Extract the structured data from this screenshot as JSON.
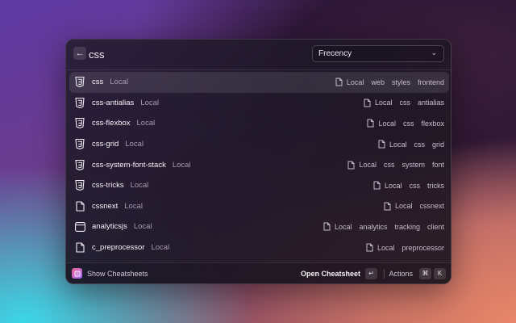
{
  "search": {
    "back_icon": "arrow-left-icon",
    "query": "css",
    "sort": {
      "selected": "Frecency",
      "chevron": "chevron-down-icon"
    }
  },
  "results": [
    {
      "title": "css",
      "subtitle": "Local",
      "icon": "css3-icon",
      "selected": true,
      "tags": [
        "Local",
        "web",
        "styles",
        "frontend"
      ]
    },
    {
      "title": "css-antialias",
      "subtitle": "Local",
      "icon": "css3-icon",
      "tags": [
        "Local",
        "css",
        "antialias"
      ]
    },
    {
      "title": "css-flexbox",
      "subtitle": "Local",
      "icon": "css3-icon",
      "tags": [
        "Local",
        "css",
        "flexbox"
      ]
    },
    {
      "title": "css-grid",
      "subtitle": "Local",
      "icon": "css3-icon",
      "tags": [
        "Local",
        "css",
        "grid"
      ]
    },
    {
      "title": "css-system-font-stack",
      "subtitle": "Local",
      "icon": "css3-icon",
      "tags": [
        "Local",
        "css",
        "system",
        "font"
      ]
    },
    {
      "title": "css-tricks",
      "subtitle": "Local",
      "icon": "css3-icon",
      "tags": [
        "Local",
        "css",
        "tricks"
      ]
    },
    {
      "title": "cssnext",
      "subtitle": "Local",
      "icon": "file-icon",
      "tags": [
        "Local",
        "cssnext"
      ]
    },
    {
      "title": "analyticsjs",
      "subtitle": "Local",
      "icon": "window-icon",
      "tags": [
        "Local",
        "analytics",
        "tracking",
        "client"
      ]
    },
    {
      "title": "c_preprocessor",
      "subtitle": "Local",
      "icon": "file-icon",
      "tags": [
        "Local",
        "preprocessor"
      ]
    }
  ],
  "footer": {
    "left_label": "Show Cheatsheets",
    "primary_action": "Open Cheatsheet",
    "primary_key": "↵",
    "actions_label": "Actions",
    "actions_keys": [
      "⌘",
      "K"
    ]
  },
  "colors": {
    "accent_logo_start": "#f06292",
    "accent_logo_end": "#9c6bff",
    "selected_row": "rgba(255,255,255,0.1)"
  }
}
